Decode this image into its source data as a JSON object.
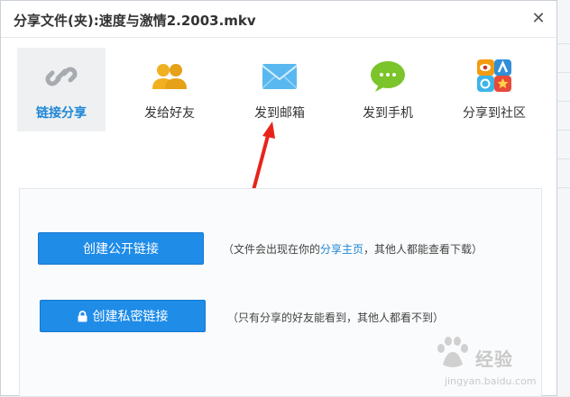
{
  "dialog": {
    "title": "分享文件(夹):速度与激情2.2003.mkv",
    "close_icon": "close-icon"
  },
  "tabs": [
    {
      "id": "link",
      "label": "链接分享",
      "icon": "link-icon",
      "active": true
    },
    {
      "id": "friend",
      "label": "发给好友",
      "icon": "friends-icon",
      "active": false
    },
    {
      "id": "email",
      "label": "发到邮箱",
      "icon": "email-icon",
      "active": false
    },
    {
      "id": "phone",
      "label": "发到手机",
      "icon": "message-icon",
      "active": false
    },
    {
      "id": "social",
      "label": "分享到社区",
      "icon": "social-icon",
      "active": false
    }
  ],
  "panel": {
    "public_button": "创建公开链接",
    "public_note_prefix": "（文件会出现在你的",
    "public_note_link": "分享主页",
    "public_note_suffix": "，其他人都能查看下载）",
    "private_button": "创建私密链接",
    "private_note": "（只有分享的好友能看到，其他人都看不到）"
  },
  "watermark": {
    "text": "经验",
    "url": "jingyan.baidu.com"
  },
  "colors": {
    "accent": "#1f8ce8",
    "link_blue": "#1f86d6",
    "arrow_red": "#e8231b"
  }
}
